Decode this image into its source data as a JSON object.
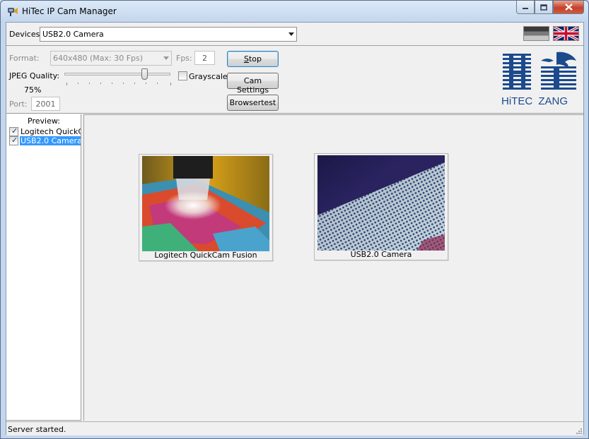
{
  "window": {
    "title": "HiTec IP Cam Manager"
  },
  "devices": {
    "label": "Devices:",
    "selected": "USB2.0 Camera"
  },
  "settings": {
    "format_label": "Format:",
    "format_value": "640x480 (Max: 30 Fps)",
    "fps_label": "Fps:",
    "fps_value": "2",
    "jpeg_label": "JPEG Quality:",
    "jpeg_value": "75%",
    "jpeg_level": 0.75,
    "grayscale_label": "Grayscale",
    "grayscale_checked": false,
    "port_label": "Port:",
    "port_value": "2001"
  },
  "buttons": {
    "stop_prefix": "",
    "stop_underline": "S",
    "stop_rest": "top",
    "cam_settings": "Cam Settings",
    "browsertest": "Browsertest"
  },
  "logo": {
    "text_hi": "HiTEC",
    "text_zang": "ZANG",
    "color": "#1c4a8c"
  },
  "preview": {
    "title": "Preview:",
    "items": [
      {
        "label": "Logitech QuickCam Fusion",
        "checked": true,
        "selected": false
      },
      {
        "label": "USB2.0 Camera",
        "checked": true,
        "selected": true
      }
    ]
  },
  "cameras": [
    {
      "label": "Logitech QuickCam Fusion"
    },
    {
      "label": "USB2.0 Camera"
    }
  ],
  "status": {
    "text": "Server started."
  },
  "colors": {
    "selection": "#3399ff",
    "close_button": "#c7402b"
  }
}
